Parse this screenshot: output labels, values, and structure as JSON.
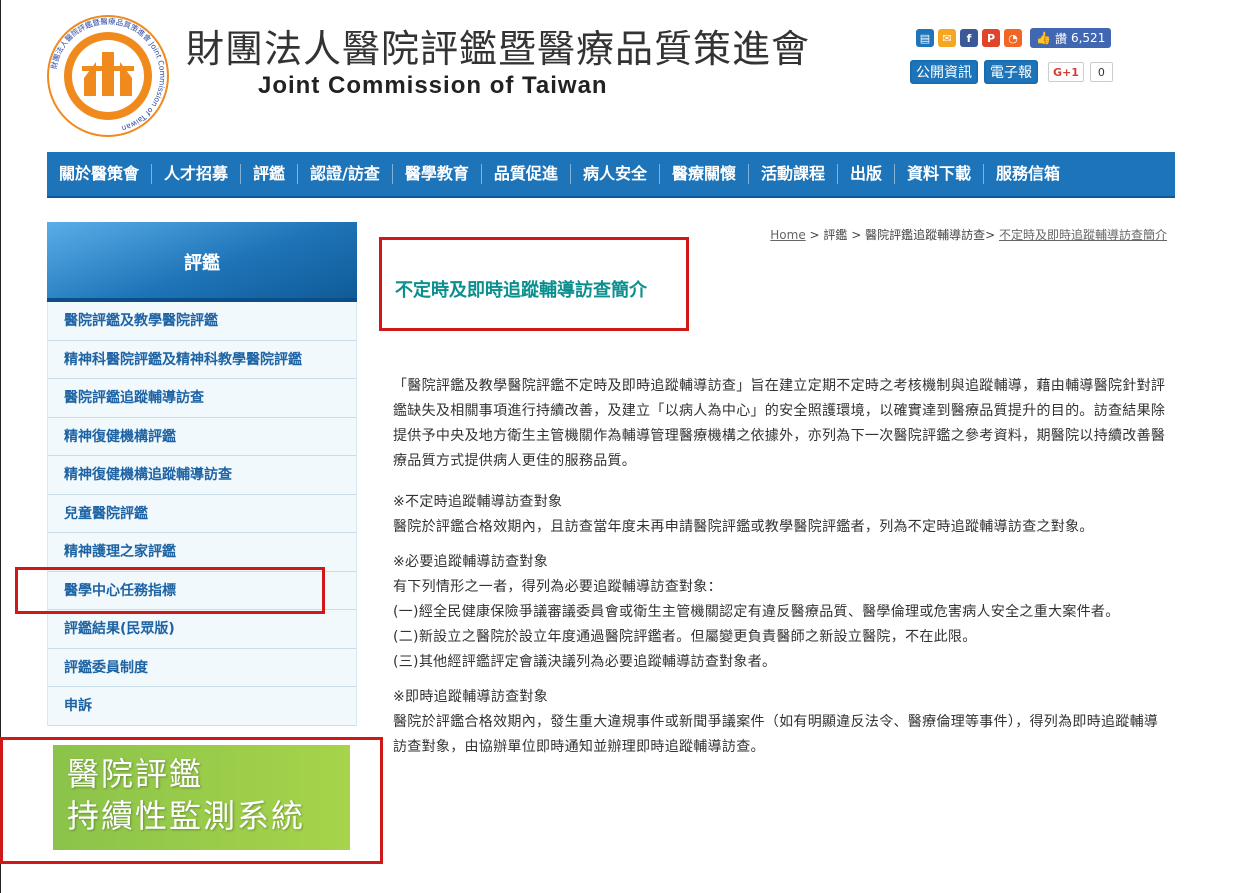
{
  "header": {
    "org_zh": "財團法人醫院評鑑暨醫療品質策進會",
    "org_en": "Joint Commission of Taiwan",
    "logo_ring_text": "財團法人醫院評鑑暨醫療品質策進會 Joint Commission of Taiwan",
    "like_label": "讚",
    "like_count": "6,521",
    "public_info": "公開資訊",
    "epaper": "電子報",
    "gplus": "G+1",
    "gplus_count": "0"
  },
  "nav": [
    "關於醫策會",
    "人才招募",
    "評鑑",
    "認證/訪查",
    "醫學教育",
    "品質促進",
    "病人安全",
    "醫療關懷",
    "活動課程",
    "出版",
    "資料下載",
    "服務信箱"
  ],
  "sidebar": {
    "title": "評鑑",
    "items": [
      "醫院評鑑及教學醫院評鑑",
      "精神科醫院評鑑及精神科教學醫院評鑑",
      "醫院評鑑追蹤輔導訪查",
      "精神復健機構評鑑",
      "精神復健機構追蹤輔導訪查",
      "兒童醫院評鑑",
      "精神護理之家評鑑",
      "醫學中心任務指標",
      "評鑑結果(民眾版)",
      "評鑑委員制度",
      "申訴"
    ]
  },
  "banner": {
    "line1": "醫院評鑑",
    "line2": "持續性監測系統"
  },
  "breadcrumb": {
    "home": "Home",
    "sep1": " > ",
    "level1": "評鑑",
    "sep2": " > ",
    "level2": "醫院評鑑追蹤輔導訪查",
    "sep3": "> ",
    "current": "不定時及即時追蹤輔導訪查簡介"
  },
  "main": {
    "title": "不定時及即時追蹤輔導訪查簡介",
    "intro": "「醫院評鑑及教學醫院評鑑不定時及即時追蹤輔導訪查」旨在建立定期不定時之考核機制與追蹤輔導，藉由輔導醫院針對評鑑缺失及相關事項進行持續改善，及建立「以病人為中心」的安全照護環境，以確實達到醫療品質提升的目的。訪查結果除提供予中央及地方衛生主管機關作為輔導管理醫療機構之依據外，亦列為下一次醫院評鑑之參考資料，期醫院以持續改善醫療品質方式提供病人更佳的服務品質。",
    "s1_head": "※不定時追蹤輔導訪查對象",
    "s1_body": "醫院於評鑑合格效期內，且訪查當年度未再申請醫院評鑑或教學醫院評鑑者，列為不定時追蹤輔導訪查之對象。",
    "s2_head": "※必要追蹤輔導訪查對象",
    "s2_lead": "有下列情形之一者，得列為必要追蹤輔導訪查對象：",
    "s2_i1": "(一)經全民健康保險爭議審議委員會或衛生主管機關認定有違反醫療品質、醫學倫理或危害病人安全之重大案件者。",
    "s2_i2": "(二)新設立之醫院於設立年度通過醫院評鑑者。但屬變更負責醫師之新設立醫院，不在此限。",
    "s2_i3": "(三)其他經評鑑評定會議決議列為必要追蹤輔導訪查對象者。",
    "s3_head": "※即時追蹤輔導訪查對象",
    "s3_body": "醫院於評鑑合格效期內，發生重大違規事件或新聞爭議案件（如有明顯違反法令、醫療倫理等事件），得列為即時追蹤輔導訪查對象，由協辦單位即時通知並辦理即時追蹤輔導訪查。"
  },
  "colors": {
    "nav_blue": "#1e74b8",
    "title_teal": "#0a8f8f",
    "side_text": "#1e63a4",
    "logo_orange": "#f08a1c",
    "highlight_red": "#d01818",
    "banner_green": "#8bc34a"
  }
}
